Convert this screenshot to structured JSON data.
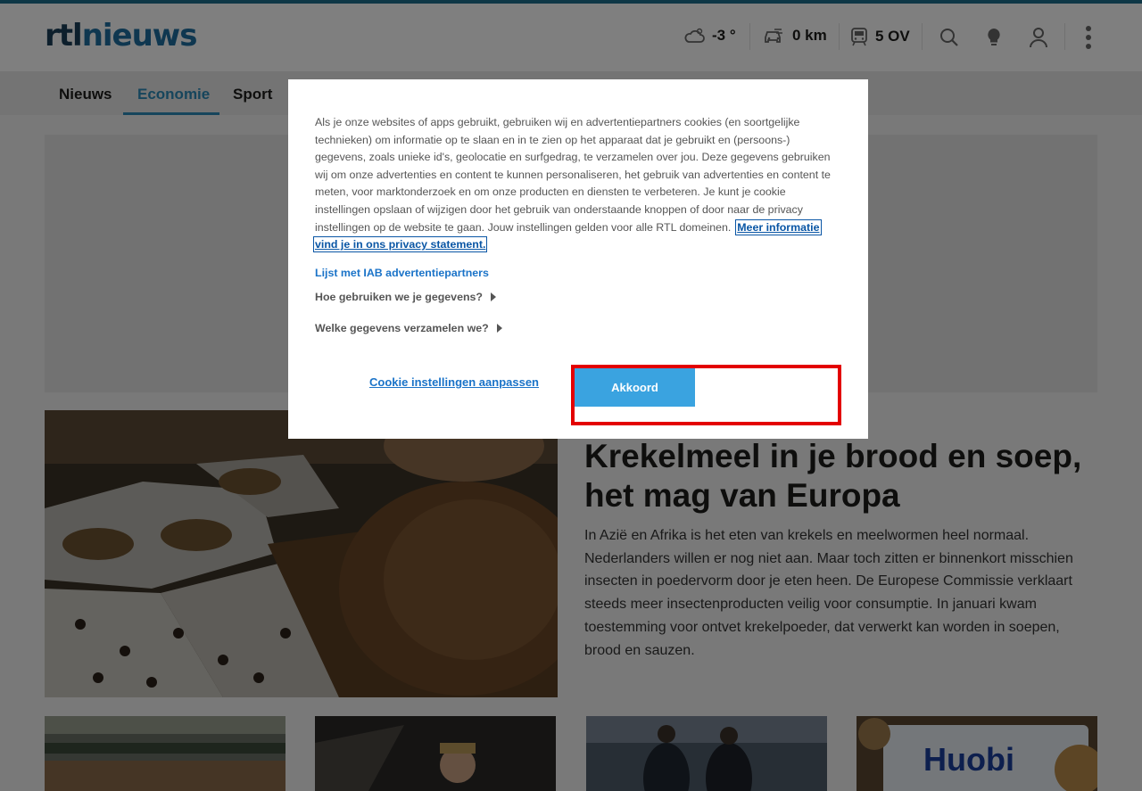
{
  "header": {
    "logo_rtl": "rtl",
    "logo_nieuws": "nieuws",
    "weather": "-3 °",
    "traffic": "0 km",
    "transit": "5 OV",
    "icons": [
      "cloud-icon",
      "car-icon",
      "train-icon",
      "search-icon",
      "lightbulb-icon",
      "user-icon",
      "more-vertical-icon"
    ]
  },
  "nav": {
    "items": [
      {
        "label": "Nieuws"
      },
      {
        "label": "Economie"
      },
      {
        "label": "Sport"
      }
    ],
    "active": "Economie"
  },
  "article": {
    "headline": "Krekelmeel in je brood en soep, het mag van Europa",
    "lead": "In Azië en Afrika is het eten van krekels en meelwormen heel normaal. Nederlanders willen er nog niet aan. Maar toch zitten er binnenkort misschien insecten in poedervorm door je eten heen. De Europese Commissie verklaart steeds meer insectenproducten veilig voor consumptie. In januari kwam toestemming voor ontvet krekelpoeder, dat verwerkt kan worden in soepen, brood en sauzen."
  },
  "thumbs": [
    {
      "caption": ""
    },
    {
      "caption": ""
    },
    {
      "caption": ""
    },
    {
      "caption": "Huobi"
    }
  ],
  "cookie_modal": {
    "body": "Als je onze websites of apps gebruikt, gebruiken wij en advertentiepartners cookies (en soortgelijke technieken) om informatie op te slaan en in te zien op het apparaat dat je gebruikt en (persoons-) gegevens, zoals unieke id's, geolocatie en surfgedrag, te verzamelen over jou. Deze gegevens gebruiken wij om onze advertenties en content te kunnen personaliseren, het gebruik van advertenties en content te meten, voor marktonderzoek en om onze producten en diensten te verbeteren. Je kunt je cookie instellingen opslaan of wijzigen door het gebruik van onderstaande knoppen of door naar de privacy instellingen op de website te gaan. Jouw instellingen gelden voor alle RTL domeinen.",
    "privacy_link": "Meer informatie vind je in ons privacy statement.",
    "iab_link": "Lijst met IAB advertentiepartners",
    "accordion_1": "Hoe gebruiken we je gegevens?",
    "accordion_2": "Welke gegevens verzamelen we?",
    "settings_link": "Cookie instellingen aanpassen",
    "accept_button": "Akkoord"
  },
  "colors": {
    "accent": "#2d8ab8",
    "button": "#3aa3e0",
    "highlight": "#e30000"
  }
}
